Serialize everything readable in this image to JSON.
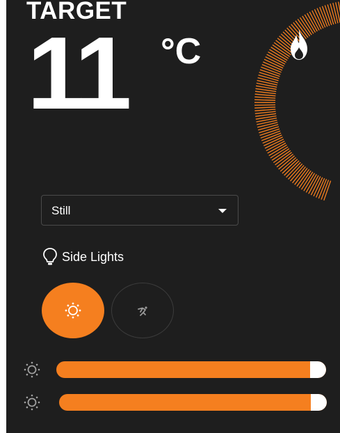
{
  "thermostat": {
    "title": "TARGET",
    "temperature": "11",
    "unit": "°C",
    "heating_icon": "flame-icon",
    "accent_color": "#f57f1f"
  },
  "preset": {
    "selected": "Still"
  },
  "lights": {
    "label": "Side Lights",
    "icon": "lightbulb-icon",
    "modes": [
      {
        "name": "brightness",
        "icon": "sun-icon",
        "active": true
      },
      {
        "name": "motion",
        "icon": "running-person-icon",
        "active": false
      }
    ],
    "sliders": [
      {
        "icon": "brightness-icon",
        "level_percent": 94
      },
      {
        "icon": "brightness-icon",
        "level_percent": 94
      }
    ]
  }
}
